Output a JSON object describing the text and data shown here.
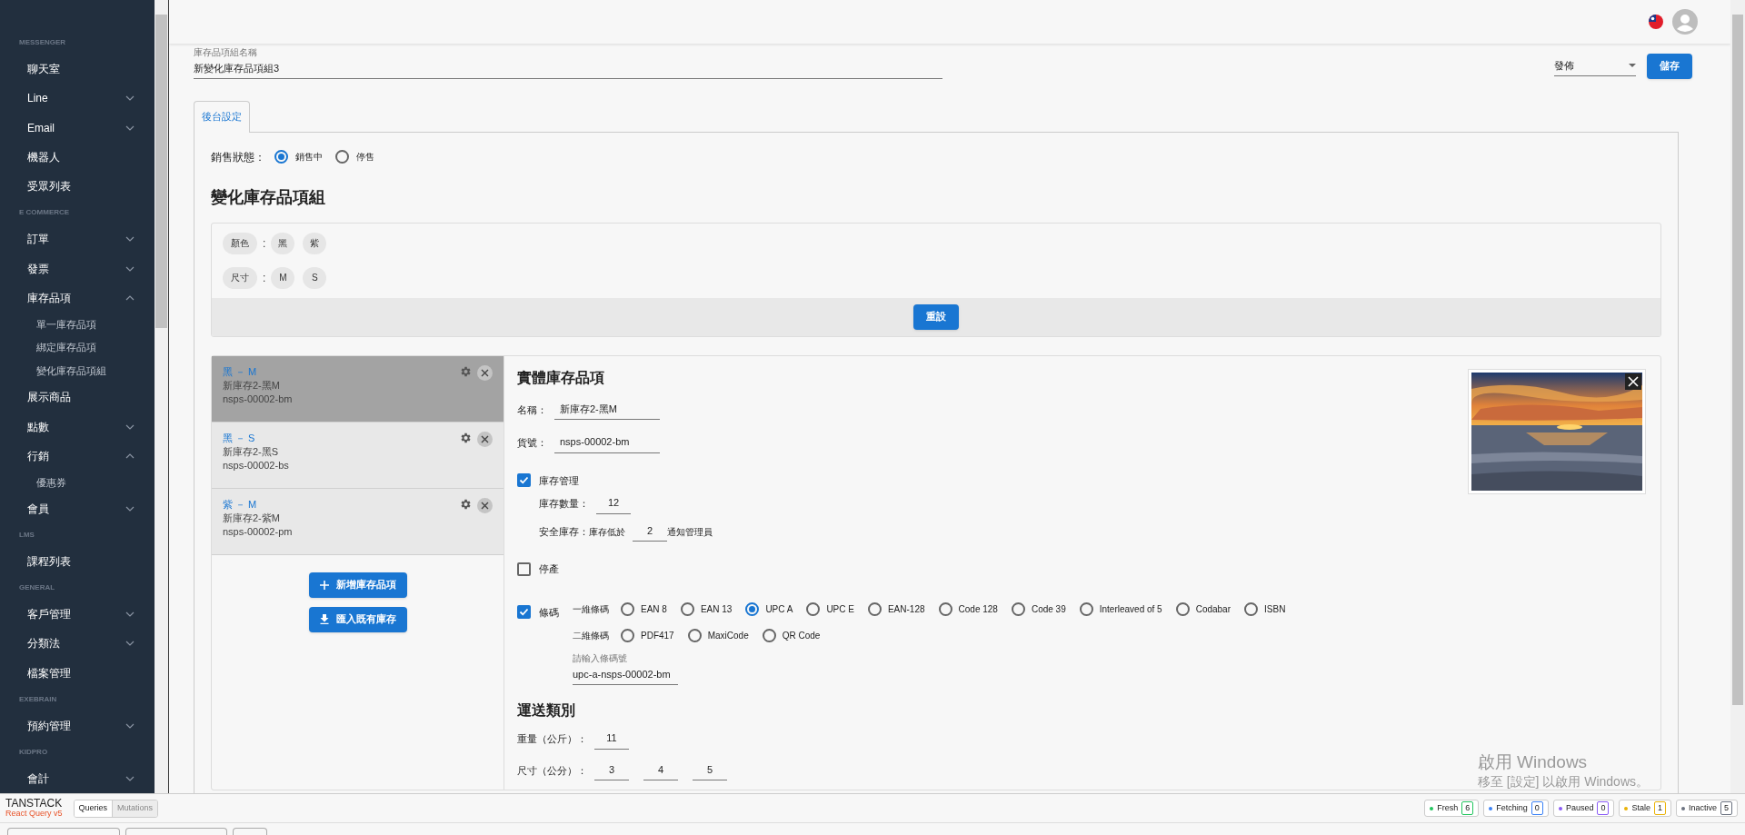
{
  "sidebar": {
    "sections": [
      {
        "heading": "MESSENGER",
        "items": [
          {
            "label": "聊天室"
          },
          {
            "label": "Line",
            "expanded": false
          },
          {
            "label": "Email",
            "expanded": false
          },
          {
            "label": "機器人"
          },
          {
            "label": "受眾列表"
          }
        ]
      },
      {
        "heading": "E COMMERCE",
        "items": [
          {
            "label": "訂單",
            "expanded": false
          },
          {
            "label": "發票",
            "expanded": false
          },
          {
            "label": "庫存品項",
            "expanded": true,
            "children": [
              {
                "label": "單一庫存品項"
              },
              {
                "label": "綁定庫存品項"
              },
              {
                "label": "變化庫存品項組"
              }
            ]
          },
          {
            "label": "展示商品"
          },
          {
            "label": "點數",
            "expanded": false
          },
          {
            "label": "行銷",
            "expanded": true,
            "children": [
              {
                "label": "優惠券"
              }
            ]
          },
          {
            "label": "會員",
            "expanded": false
          }
        ]
      },
      {
        "heading": "LMS",
        "items": [
          {
            "label": "課程列表"
          }
        ]
      },
      {
        "heading": "GENERAL",
        "items": [
          {
            "label": "客戶管理",
            "expanded": false
          },
          {
            "label": "分類法",
            "expanded": false
          },
          {
            "label": "檔案管理"
          }
        ]
      },
      {
        "heading": "EXEBRAIN",
        "items": [
          {
            "label": "預約管理",
            "expanded": false
          }
        ]
      },
      {
        "heading": "KIDPRO",
        "items": [
          {
            "label": "會計",
            "expanded": false
          }
        ]
      }
    ]
  },
  "form": {
    "name_label": "庫存品項組名稱",
    "name_value": "新變化庫存品項組3",
    "status_value": "發佈",
    "save_button": "儲存"
  },
  "tabs": [
    {
      "label": "後台設定",
      "selected": true
    }
  ],
  "sales_status": {
    "label": "銷售狀態：",
    "options": [
      {
        "label": "銷售中",
        "selected": true
      },
      {
        "label": "停售",
        "selected": false
      }
    ]
  },
  "variant_group": {
    "title": "變化庫存品項組",
    "attributes": [
      {
        "name": "顏色",
        "colon": ":",
        "values": [
          "黑",
          "紫"
        ]
      },
      {
        "name": "尺寸",
        "colon": ":",
        "values": [
          "M",
          "S"
        ]
      }
    ],
    "reset_button": "重設"
  },
  "variants": [
    {
      "title": "黑 － M",
      "name": "新庫存2-黑M",
      "sku": "nsps-00002-bm",
      "selected": true
    },
    {
      "title": "黑 － S",
      "name": "新庫存2-黑S",
      "sku": "nsps-00002-bs",
      "selected": false
    },
    {
      "title": "紫 － M",
      "name": "新庫存2-紫M",
      "sku": "nsps-00002-pm",
      "selected": false
    }
  ],
  "add_button": "新增庫存品項",
  "import_button": "匯入既有庫存",
  "detail": {
    "title": "實體庫存品項",
    "name_label": "名稱：",
    "name_value": "新庫存2-黑M",
    "sku_label": "貨號：",
    "sku_value": "nsps-00002-bm",
    "stock_management": {
      "label": "庫存管理",
      "checked": true
    },
    "quantity_label": "庫存數量：",
    "quantity_value": "12",
    "safety_label": "安全庫存：",
    "safety_prefix": "庫存低於",
    "safety_value": "2",
    "safety_suffix": "通知管理員",
    "discontinued": {
      "label": "停產",
      "checked": false
    },
    "barcode": {
      "label": "條碼",
      "checked": true,
      "groups": [
        {
          "label": "一維條碼",
          "options": [
            {
              "label": "EAN 8",
              "selected": false
            },
            {
              "label": "EAN 13",
              "selected": false
            },
            {
              "label": "UPC A",
              "selected": true
            },
            {
              "label": "UPC E",
              "selected": false
            },
            {
              "label": "EAN-128",
              "selected": false
            },
            {
              "label": "Code 128",
              "selected": false
            },
            {
              "label": "Code 39",
              "selected": false
            },
            {
              "label": "Interleaved of 5",
              "selected": false
            },
            {
              "label": "Codabar",
              "selected": false
            },
            {
              "label": "ISBN",
              "selected": false
            }
          ]
        },
        {
          "label": "二維條碼",
          "options": [
            {
              "label": "PDF417",
              "selected": false
            },
            {
              "label": "MaxiCode",
              "selected": false
            },
            {
              "label": "QR Code",
              "selected": false
            }
          ]
        }
      ],
      "input_label": "請輸入條碼號",
      "input_value": "upc-a-nsps-00002-bm"
    }
  },
  "shipping": {
    "title": "運送類別",
    "weight_label": "重量（公斤）：",
    "weight_value": "11",
    "size_label": "尺寸（公分）：",
    "size_values": [
      "3",
      "4",
      "5"
    ]
  },
  "devtools": {
    "brand": "TANSTACK",
    "product": "React Query v5",
    "tabs": [
      {
        "label": "Queries",
        "selected": true
      },
      {
        "label": "Mutations",
        "selected": false
      }
    ],
    "counters": [
      {
        "label": "Fresh",
        "count": "6",
        "color": "#22c55e"
      },
      {
        "label": "Fetching",
        "count": "0",
        "color": "#3b82f6"
      },
      {
        "label": "Paused",
        "count": "0",
        "color": "#8b5cf6"
      },
      {
        "label": "Stale",
        "count": "1",
        "color": "#eab308"
      },
      {
        "label": "Inactive",
        "count": "5",
        "color": "#6b7280"
      }
    ]
  },
  "os_notice": {
    "lines": [
      "啟用 Windows",
      "移至 [設定] 以啟用 Windows。"
    ]
  }
}
